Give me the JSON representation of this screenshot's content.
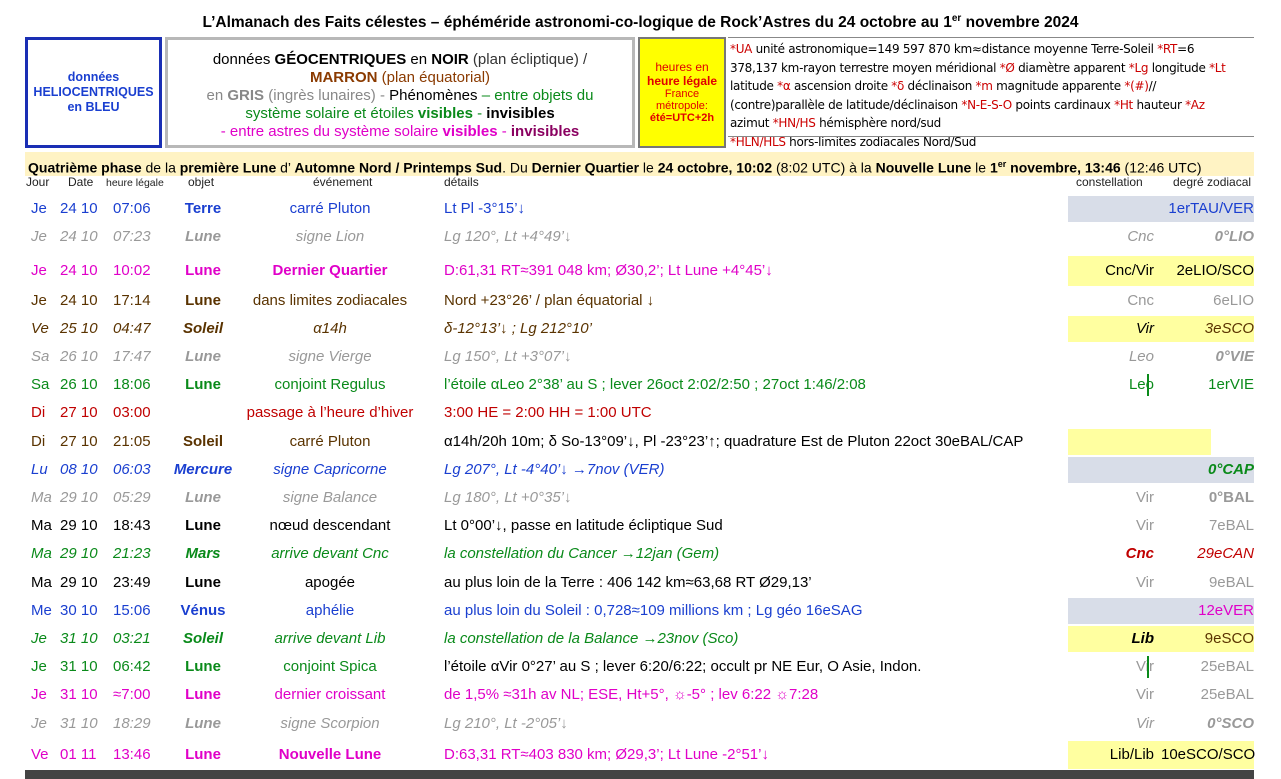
{
  "title": "L’Almanach des Faits célestes – éphéméride astronomi-co-logique de Rock’Astres du 24 octobre au 1",
  "title_sup": "er",
  "title_end": " novembre 2024",
  "helio": [
    "données",
    "HELIOCENTRIQUES",
    "en BLEU"
  ],
  "geo": {
    "l1a": "données ",
    "l1b": "GÉOCENTRIQUES",
    "l1c": " en ",
    "l1d": "NOIR",
    "l1e": " (plan écliptique)  /",
    "l2a": "MARRON",
    "l2b": " (plan équatorial)",
    "l3a": "en ",
    "l3b": "GRIS",
    "l3c": " (ingrès lunaires)  -  ",
    "l3d": "Phénomènes",
    "l3e": " – entre objets du",
    "l4a": "système solaire et étoiles ",
    "l4b": "visibles",
    "l4c": " - ",
    "l4d": "invisibles",
    "l5a": "- entre astres du système solaire ",
    "l5b": "visibles",
    "l5c": " - ",
    "l5d": "invisibles"
  },
  "heures": [
    "heures en",
    "heure légale",
    "France",
    "métropole:",
    "été=UTC+2h"
  ],
  "notes": {
    "n1": "unité astronomique=149 597 870 km≈distance moyenne Terre-Soleil  ",
    "n2": "=6",
    "n3": "378,137 km-rayon terrestre moyen méridional  ",
    "n4": " diamètre apparent  ",
    "n5": " longitude ",
    "n6": "latitude  ",
    "n7": " ascension droite ",
    "n8": " déclinaison  ",
    "n9": " magnitude apparente  ",
    "n10": "(contre)parallèle de latitude/déclinaison  ",
    "n11": " points cardinaux  ",
    "n12": " hauteur ",
    "n13": "azimut  ",
    "n14": " hémisphère nord/sud",
    "n15": " hors-limites zodiacales Nord/Sud"
  },
  "phase": {
    "a": "Quatrième phase",
    "b": " de la ",
    "c": "première Lune",
    "d": " d’ ",
    "e": "Automne Nord / Printemps Sud",
    "f": ". Du ",
    "g": "Dernier Quartier",
    "h": " le ",
    "i": "24 octobre, 10:02",
    "j": " (8:02 UTC) à la ",
    "k": "Nouvelle Lune",
    "l": " le ",
    "m": "1",
    "m_sup": "er",
    "n": " novembre, 13:46",
    "o": " (12:46 UTC)"
  },
  "headers": {
    "jour": "Jour",
    "date": "Date",
    "heure": "heure légale",
    "objet": "objet",
    "evenement": "événement",
    "details": "détails",
    "constellation": "constellation",
    "degre": "degré zodiacal"
  },
  "rows": [
    {
      "day": "Je",
      "date": "24 10",
      "time": "07:06",
      "obj": "Terre",
      "evt": "carré Pluton",
      "det": "Lt Pl -3°15’↓",
      "const": "",
      "deg": "1erTAU/VER"
    },
    {
      "day": "Je",
      "date": "24 10",
      "time": "07:23",
      "obj": "Lune",
      "evt": "signe Lion",
      "det": "Lg 120°, Lt +4°49’↓",
      "const": "Cnc",
      "deg": "0°LIO"
    },
    {
      "day": "Je",
      "date": "24 10",
      "time": "10:02",
      "obj": "Lune",
      "evt": "Dernier Quartier",
      "det": "D:61,31 RT≈391 048 km; Ø30,2’; Lt Lune +4°45’↓",
      "const": "Cnc/Vir",
      "deg": "2eLIO/SCO"
    },
    {
      "day": "Je",
      "date": "24 10",
      "time": "17:14",
      "obj": "Lune",
      "evt": "dans limites zodiacales",
      "det": "Nord +23°26’ / plan équatorial ↓",
      "const": "Cnc",
      "deg": "6eLIO"
    },
    {
      "day": "Ve",
      "date": "25 10",
      "time": "04:47",
      "obj": "Soleil",
      "evt": "α14h",
      "det": "δ-12°13’↓ ; Lg 212°10’",
      "const": "Vir",
      "deg": "3eSCO"
    },
    {
      "day": "Sa",
      "date": "26 10",
      "time": "17:47",
      "obj": "Lune",
      "evt": "signe Vierge",
      "det": "Lg 150°, Lt +3°07’↓",
      "const": "Leo",
      "deg": "0°VIE"
    },
    {
      "day": "Sa",
      "date": "26 10",
      "time": "18:06",
      "obj": "Lune",
      "evt": "conjoint Regulus",
      "det": "l’étoile αLeo 2°38’ au S ; lever 26oct 2:02/2:50 ; 27oct 1:46/2:08",
      "const": "Leo",
      "deg": "1erVIE"
    },
    {
      "day": "Di",
      "date": "27 10",
      "time": "03:00",
      "obj": "",
      "evt": "passage à l’heure d’hiver",
      "det": "3:00 HE = 2:00 HH = 1:00 UTC",
      "const": "",
      "deg": ""
    },
    {
      "day": "Di",
      "date": "27 10",
      "time": "21:05",
      "obj": "Soleil",
      "evt": "carré Pluton",
      "det": "α14h/20h 10m; δ So-13°09’↓, Pl -23°23’↑; quadrature Est de Pluton 22oct 30eBAL/CAP",
      "const": "",
      "deg": ""
    },
    {
      "day": "Lu",
      "date": "08 10",
      "time": "06:03",
      "obj": "Mercure",
      "evt": "signe Capricorne",
      "det": "Lg 207°, Lt -4°40’↓ →7nov (VER)",
      "const": "",
      "deg": "0°CAP"
    },
    {
      "day": "Ma",
      "date": "29 10",
      "time": "05:29",
      "obj": "Lune",
      "evt": "signe Balance",
      "det": "Lg 180°, Lt +0°35’↓",
      "const": "Vir",
      "deg": "0°BAL"
    },
    {
      "day": "Ma",
      "date": "29 10",
      "time": "18:43",
      "obj": "Lune",
      "evt": "nœud descendant",
      "det": "Lt 0°00’↓, passe en latitude écliptique Sud",
      "const": "Vir",
      "deg": "7eBAL"
    },
    {
      "day": "Ma",
      "date": "29 10",
      "time": "21:23",
      "obj": "Mars",
      "evt": "arrive devant Cnc",
      "det": "la constellation du Cancer →12jan (Gem)",
      "const": "Cnc",
      "deg": "29eCAN"
    },
    {
      "day": "Ma",
      "date": "29 10",
      "time": "23:49",
      "obj": "Lune",
      "evt": "apogée",
      "det": "au plus loin de la Terre : 406 142 km≈63,68 RT  Ø29,13’",
      "const": "Vir",
      "deg": "9eBAL"
    },
    {
      "day": "Me",
      "date": "30 10",
      "time": "15:06",
      "obj": "Vénus",
      "evt": "aphélie",
      "det": "au plus loin du Soleil : 0,728≈109 millions km ; Lg géo 16eSAG",
      "const": "",
      "deg": "12eVER"
    },
    {
      "day": "Je",
      "date": "31 10",
      "time": "03:21",
      "obj": "Soleil",
      "evt": "arrive devant Lib",
      "det": "la constellation de la Balance →23nov (Sco)",
      "const": "Lib",
      "deg": "9eSCO"
    },
    {
      "day": "Je",
      "date": "31 10",
      "time": "06:42",
      "obj": "Lune",
      "evt": "conjoint Spica",
      "det": "l’étoile αVir 0°27’ au S ; lever 6:20/6:22; occult pr NE Eur, O Asie, Indon.",
      "const": "Vir",
      "deg": "25eBAL"
    },
    {
      "day": "Je",
      "date": "31 10",
      "time": "≈7:00",
      "obj": "Lune",
      "evt": "dernier croissant",
      "det": "de 1,5% ≈31h av NL; ESE, Ht+5°, ☼-5° ; lev 6:22 ☼7:28",
      "const": "Vir",
      "deg": "25eBAL"
    },
    {
      "day": "Je",
      "date": "31 10",
      "time": "18:29",
      "obj": "Lune",
      "evt": "signe Scorpion",
      "det": "Lg 210°, Lt -2°05’↓",
      "const": "Vir",
      "deg": "0°SCO"
    },
    {
      "day": "Ve",
      "date": "01 11",
      "time": "13:46",
      "obj": "Lune",
      "evt": "Nouvelle Lune",
      "det": "D:63,31 RT≈403 830 km; Ø29,3’; Lt Lune -2°51’↓",
      "const": "Lib/Lib",
      "deg": "10eSCO/SCO"
    }
  ],
  "colors": {
    "blue": "#1a3fd0",
    "gray": "#999999",
    "magenta": "#e000c8",
    "brown": "#5a3300",
    "green": "#0a8a1a",
    "red": "#c00000",
    "yellow": "#ffff00",
    "phase_bg": "#fff3c4",
    "const_yellow": "#ffffa0",
    "const_blue": "#d8dde8"
  }
}
